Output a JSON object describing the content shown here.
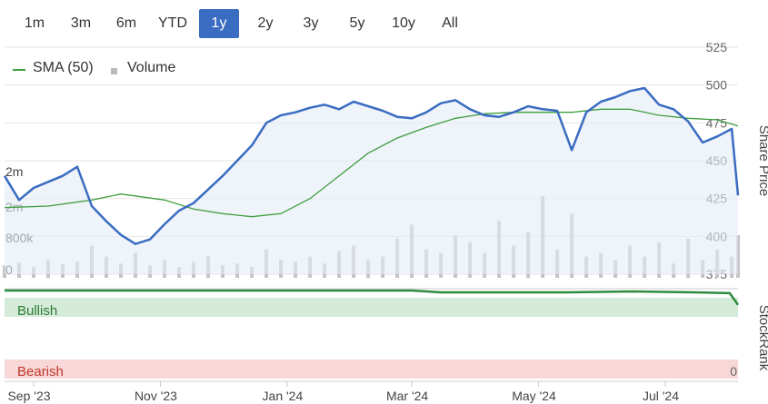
{
  "range_selector": {
    "active": "1y",
    "options": [
      "1m",
      "3m",
      "6m",
      "YTD",
      "1y",
      "2y",
      "3y",
      "5y",
      "10y",
      "All"
    ]
  },
  "legend": {
    "sma_label": "SMA (50)",
    "volume_label": "Volume"
  },
  "colors": {
    "price": "#3a6cc1",
    "sma": "#3f9e3f",
    "volume": "#c4c4c4",
    "stockrank": "#2e8b3e",
    "bullish_band": "#d3ebd8",
    "bearish_band": "#f7d7d7",
    "active_button": "#3a6cc1"
  },
  "chart_data": [
    {
      "type": "line",
      "xlabel": "",
      "ylabel": "Share Price",
      "ylim": [
        375,
        525
      ],
      "yticks": [
        "525",
        "500",
        "475",
        "450",
        "425",
        "400",
        "375"
      ],
      "xticks": [
        "Sep '23",
        "Nov '23",
        "Jan '24",
        "Mar '24",
        "May '24",
        "Jul '24"
      ],
      "grid": true,
      "legend_position": "top-left",
      "series": [
        {
          "name": "Share Price",
          "x": [
            "2023-08-18",
            "2023-08-25",
            "2023-09-01",
            "2023-09-08",
            "2023-09-15",
            "2023-09-22",
            "2023-09-29",
            "2023-10-06",
            "2023-10-13",
            "2023-10-20",
            "2023-10-27",
            "2023-11-03",
            "2023-11-10",
            "2023-11-17",
            "2023-11-24",
            "2023-12-01",
            "2023-12-08",
            "2023-12-15",
            "2023-12-22",
            "2023-12-29",
            "2024-01-05",
            "2024-01-12",
            "2024-01-19",
            "2024-01-26",
            "2024-02-02",
            "2024-02-09",
            "2024-02-16",
            "2024-02-23",
            "2024-03-01",
            "2024-03-08",
            "2024-03-15",
            "2024-03-22",
            "2024-03-29",
            "2024-04-05",
            "2024-04-12",
            "2024-04-19",
            "2024-04-26",
            "2024-05-03",
            "2024-05-10",
            "2024-05-17",
            "2024-05-24",
            "2024-05-31",
            "2024-06-07",
            "2024-06-14",
            "2024-06-21",
            "2024-06-28",
            "2024-07-05",
            "2024-07-12",
            "2024-07-19",
            "2024-07-26",
            "2024-08-02",
            "2024-08-05"
          ],
          "values": [
            440,
            424,
            432,
            436,
            440,
            446,
            420,
            410,
            401,
            395,
            398,
            408,
            417,
            422,
            431,
            440,
            450,
            460,
            475,
            480,
            482,
            485,
            487,
            484,
            489,
            486,
            483,
            479,
            478,
            482,
            488,
            490,
            484,
            480,
            479,
            482,
            486,
            484,
            483,
            457,
            482,
            489,
            492,
            496,
            498,
            487,
            484,
            476,
            462,
            466,
            471,
            427
          ]
        },
        {
          "name": "SMA (50)",
          "x": [
            "2023-08-18",
            "2023-09-08",
            "2023-09-29",
            "2023-10-13",
            "2023-11-03",
            "2023-11-17",
            "2023-12-01",
            "2023-12-15",
            "2023-12-29",
            "2024-01-12",
            "2024-01-26",
            "2024-02-09",
            "2024-02-23",
            "2024-03-08",
            "2024-03-22",
            "2024-04-05",
            "2024-04-19",
            "2024-05-03",
            "2024-05-17",
            "2024-05-31",
            "2024-06-14",
            "2024-06-28",
            "2024-07-12",
            "2024-07-26",
            "2024-08-05"
          ],
          "values": [
            419,
            420,
            424,
            428,
            424,
            418,
            415,
            413,
            415,
            425,
            440,
            455,
            465,
            472,
            478,
            481,
            482,
            482,
            482,
            484,
            484,
            480,
            478,
            477,
            473
          ]
        }
      ]
    },
    {
      "type": "bar",
      "ylabel": "",
      "yticks": [
        "2m",
        "2m",
        "800k",
        "0"
      ],
      "series": [
        {
          "name": "Volume",
          "x": [
            "2023-08-18",
            "2023-08-25",
            "2023-09-01",
            "2023-09-08",
            "2023-09-15",
            "2023-09-22",
            "2023-09-29",
            "2023-10-06",
            "2023-10-13",
            "2023-10-20",
            "2023-10-27",
            "2023-11-03",
            "2023-11-10",
            "2023-11-17",
            "2023-11-24",
            "2023-12-01",
            "2023-12-08",
            "2023-12-15",
            "2023-12-22",
            "2023-12-29",
            "2024-01-05",
            "2024-01-12",
            "2024-01-19",
            "2024-01-26",
            "2024-02-02",
            "2024-02-09",
            "2024-02-16",
            "2024-02-23",
            "2024-03-01",
            "2024-03-08",
            "2024-03-15",
            "2024-03-22",
            "2024-03-29",
            "2024-04-05",
            "2024-04-12",
            "2024-04-19",
            "2024-04-26",
            "2024-05-03",
            "2024-05-10",
            "2024-05-17",
            "2024-05-24",
            "2024-05-31",
            "2024-06-07",
            "2024-06-14",
            "2024-06-21",
            "2024-06-28",
            "2024-07-05",
            "2024-07-12",
            "2024-07-19",
            "2024-07-26",
            "2024-08-02",
            "2024-08-05"
          ],
          "values": [
            350000,
            420000,
            300000,
            500000,
            380000,
            450000,
            900000,
            600000,
            400000,
            700000,
            350000,
            500000,
            300000,
            450000,
            600000,
            350000,
            400000,
            300000,
            800000,
            500000,
            450000,
            600000,
            400000,
            750000,
            900000,
            500000,
            600000,
            1100000,
            1500000,
            800000,
            700000,
            1200000,
            1000000,
            700000,
            1600000,
            900000,
            1300000,
            2300000,
            800000,
            1800000,
            600000,
            700000,
            500000,
            900000,
            600000,
            1000000,
            400000,
            1100000,
            500000,
            800000,
            600000,
            1200000
          ]
        }
      ]
    },
    {
      "type": "line",
      "ylabel": "StockRank",
      "yticks": [
        "0"
      ],
      "bands": [
        "Bullish",
        "Bearish"
      ],
      "series": [
        {
          "name": "StockRank",
          "x": [
            "2023-08-18",
            "2023-10-01",
            "2023-12-01",
            "2024-02-01",
            "2024-03-01",
            "2024-03-15",
            "2024-04-15",
            "2024-05-15",
            "2024-06-15",
            "2024-07-15",
            "2024-08-01",
            "2024-08-05"
          ],
          "values": [
            98,
            98,
            98,
            98,
            98,
            96,
            96,
            96,
            97,
            96,
            95,
            82
          ]
        }
      ]
    }
  ]
}
